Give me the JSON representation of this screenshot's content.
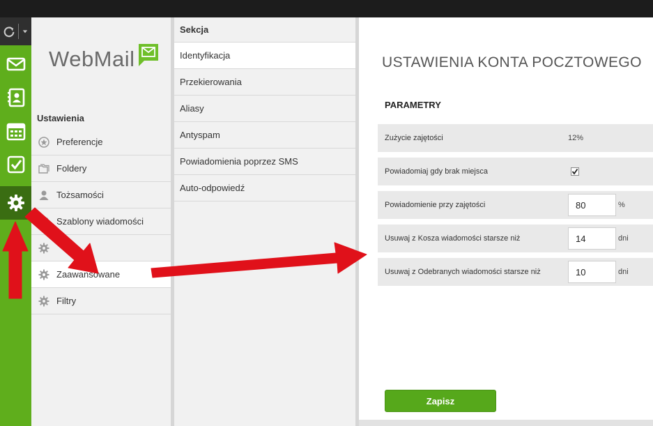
{
  "app": {
    "logo_text": "WebMail"
  },
  "rail": {
    "items": [
      {
        "icon": "mail-icon",
        "active": false
      },
      {
        "icon": "contacts-icon",
        "active": false
      },
      {
        "icon": "calendar-icon",
        "active": false
      },
      {
        "icon": "tasks-icon",
        "active": false
      },
      {
        "icon": "gear-icon",
        "active": true
      }
    ]
  },
  "settings": {
    "heading": "Ustawienia",
    "items": [
      {
        "label": "Preferencje",
        "icon": "star-icon"
      },
      {
        "label": "Foldery",
        "icon": "folder-icon"
      },
      {
        "label": "Tożsamości",
        "icon": "user-icon"
      },
      {
        "label": "Szablony wiadomości",
        "icon": "gear-icon"
      },
      {
        "label": "",
        "icon": "gear-icon"
      },
      {
        "label": "Zaawansowane",
        "icon": "gear-icon",
        "active": true
      },
      {
        "label": "Filtry",
        "icon": "gear-icon"
      }
    ]
  },
  "section": {
    "heading": "Sekcja",
    "items": [
      {
        "label": "Identyfikacja",
        "active": true
      },
      {
        "label": "Przekierowania"
      },
      {
        "label": "Aliasy"
      },
      {
        "label": "Antyspam"
      },
      {
        "label": "Powiadomienia poprzez SMS"
      },
      {
        "label": "Auto-odpowiedź"
      }
    ]
  },
  "main": {
    "title": "USTAWIENIA KONTA POCZTOWEGO",
    "params_title": "PARAMETRY",
    "rows": [
      {
        "label": "Zużycie zajętości",
        "value": "12%"
      },
      {
        "label": "Powiadomiaj gdy brak miejsca",
        "checked": true
      },
      {
        "label": "Powiadomienie przy zajętości",
        "input": "80",
        "unit": "%"
      },
      {
        "label": "Usuwaj z Kosza wiadomości starsze niż",
        "input": "14",
        "unit": "dni"
      },
      {
        "label": "Usuwaj z Odebranych wiadomości starsze niż",
        "input": "10",
        "unit": "dni"
      }
    ],
    "save_label": "Zapisz"
  },
  "colors": {
    "brand_green": "#5fae1c",
    "rail_active": "#3a6d12",
    "annotation_red": "#e0111a"
  }
}
